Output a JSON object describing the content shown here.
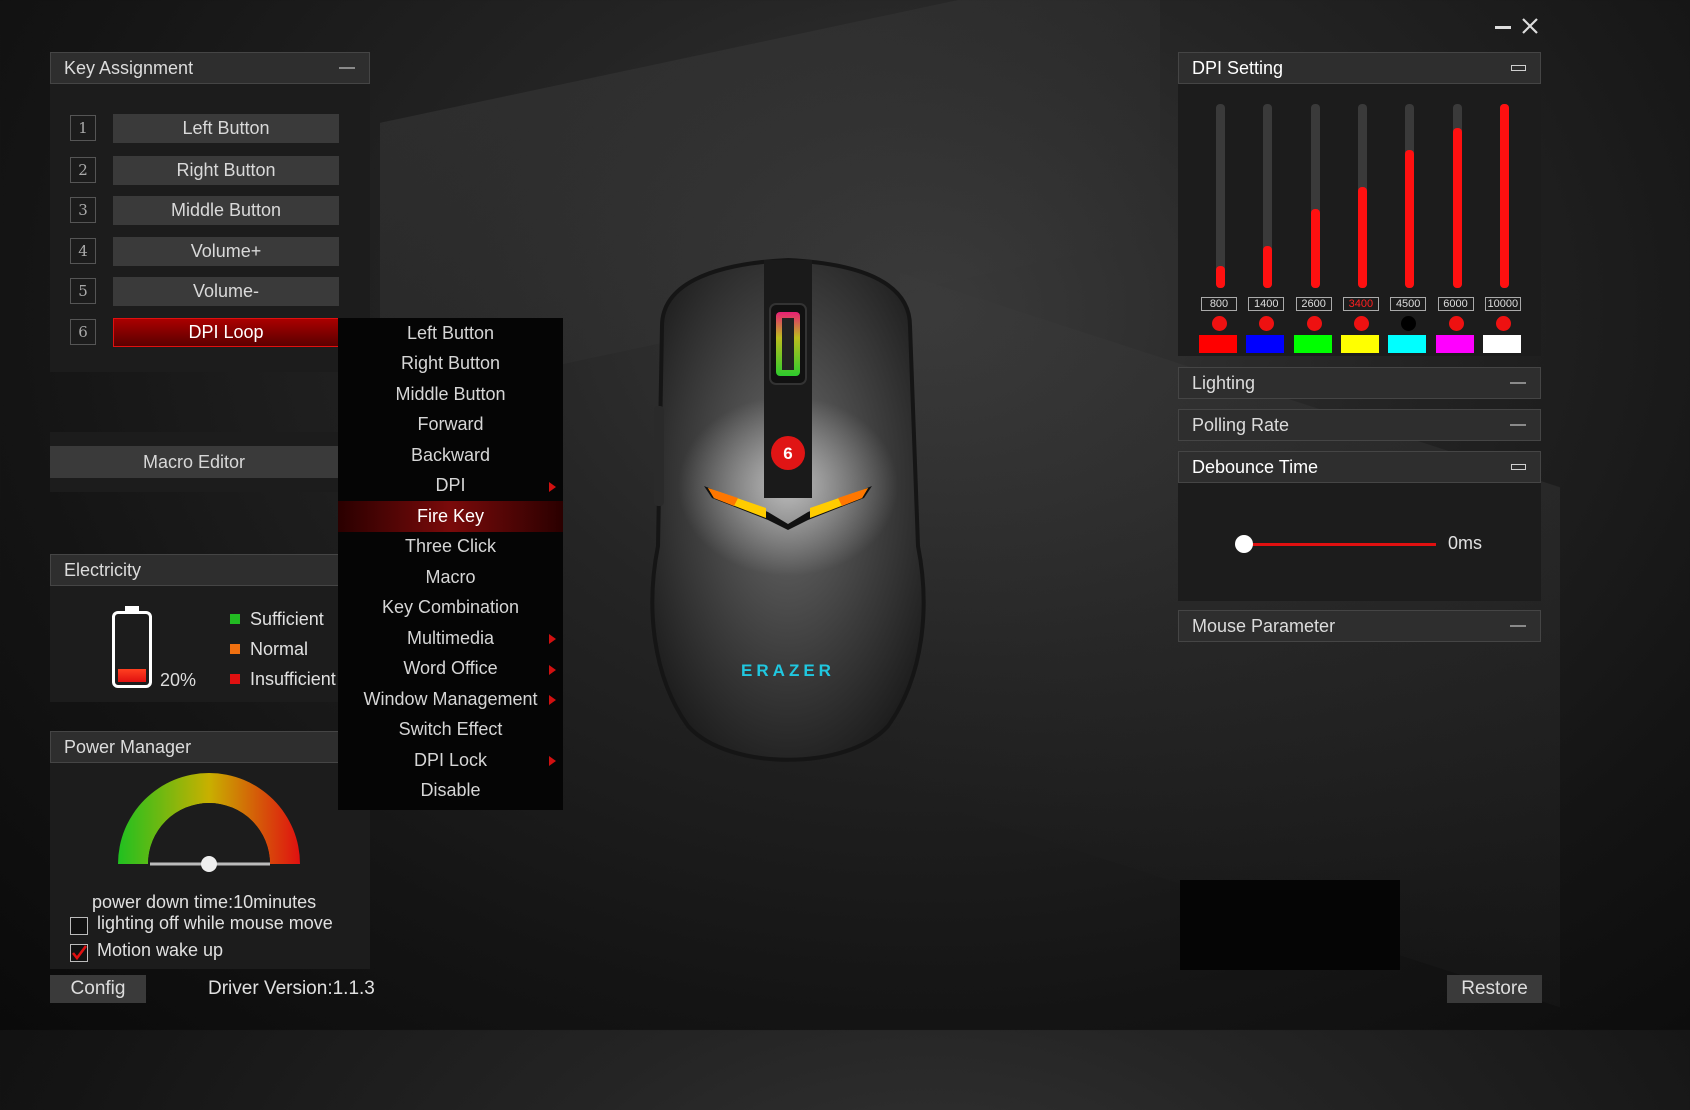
{
  "window": {
    "minimize_label": "—",
    "close_label": "✕"
  },
  "key_assignment": {
    "title": "Key Assignment",
    "rows": [
      {
        "num": "1",
        "label": "Left Button"
      },
      {
        "num": "2",
        "label": "Right Button"
      },
      {
        "num": "3",
        "label": "Middle Button"
      },
      {
        "num": "4",
        "label": "Volume+"
      },
      {
        "num": "5",
        "label": "Volume-"
      },
      {
        "num": "6",
        "label": "DPI Loop"
      }
    ],
    "selected_index": 5
  },
  "macro_editor": {
    "label": "Macro Editor"
  },
  "context_menu": {
    "items": [
      {
        "label": "Left Button"
      },
      {
        "label": "Right Button"
      },
      {
        "label": "Middle Button"
      },
      {
        "label": "Forward"
      },
      {
        "label": "Backward"
      },
      {
        "label": "DPI",
        "submenu": true
      },
      {
        "label": "Fire Key",
        "selected": true
      },
      {
        "label": "Three Click"
      },
      {
        "label": "Macro"
      },
      {
        "label": "Key Combination"
      },
      {
        "label": "Multimedia",
        "submenu": true
      },
      {
        "label": "Word Office",
        "submenu": true
      },
      {
        "label": "Window Management",
        "submenu": true
      },
      {
        "label": "Switch Effect"
      },
      {
        "label": "DPI Lock",
        "submenu": true
      },
      {
        "label": "Disable"
      }
    ]
  },
  "electricity": {
    "title": "Electricity",
    "battery_percent_label": "20%",
    "battery_level": 0.2,
    "legend": [
      {
        "label": "Sufficient",
        "color": "#22bb22"
      },
      {
        "label": "Normal",
        "color": "#f07010"
      },
      {
        "label": "Insufficient",
        "color": "#e01010"
      }
    ]
  },
  "power_manager": {
    "title": "Power Manager",
    "power_down_text": "power down time:10minutes",
    "options": [
      {
        "label": "lighting off while mouse move",
        "checked": false
      },
      {
        "label": "Motion wake up",
        "checked": true
      }
    ]
  },
  "mouse": {
    "brand": "ERAZER",
    "badge": "6"
  },
  "dpi_setting": {
    "title": "DPI Setting",
    "levels": [
      {
        "value": "800",
        "fill": 0.12,
        "color": "#ff0000",
        "active": false
      },
      {
        "value": "1400",
        "fill": 0.23,
        "color": "#0000ff",
        "active": false
      },
      {
        "value": "2600",
        "fill": 0.43,
        "color": "#00ff00",
        "active": false
      },
      {
        "value": "3400",
        "fill": 0.55,
        "color": "#ffff00",
        "active": true
      },
      {
        "value": "4500",
        "fill": 0.75,
        "color": "#00ffff",
        "active": false
      },
      {
        "value": "6000",
        "fill": 0.87,
        "color": "#ff00ff",
        "active": false
      },
      {
        "value": "10000",
        "fill": 1.0,
        "color": "#ffffff",
        "active": false
      }
    ]
  },
  "lighting": {
    "title": "Lighting"
  },
  "polling_rate": {
    "title": "Polling Rate"
  },
  "debounce_time": {
    "title": "Debounce Time",
    "value_label": "0ms",
    "value": 0
  },
  "mouse_parameter": {
    "title": "Mouse Parameter"
  },
  "footer": {
    "config_label": "Config",
    "driver_version": "Driver Version:1.1.3",
    "restore_label": "Restore"
  }
}
